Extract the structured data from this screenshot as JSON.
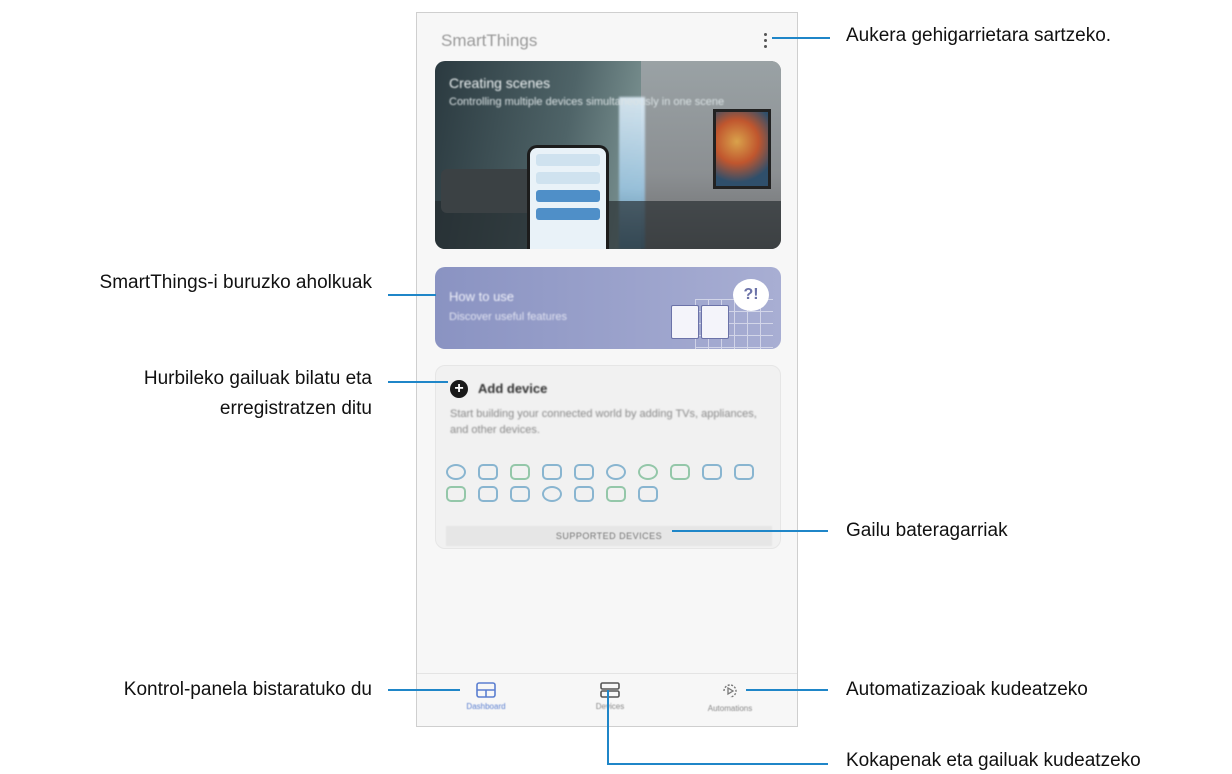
{
  "app": {
    "title": "SmartThings",
    "hero": {
      "title": "Creating scenes",
      "subtitle": "Controlling multiple devices simultaneously in one scene"
    },
    "tips": {
      "title": "How to use",
      "subtitle": "Discover useful features"
    },
    "add_device": {
      "title": "Add device",
      "description": "Start building your connected world by adding TVs, appliances, and other devices.",
      "supported_label": "SUPPORTED DEVICES"
    },
    "nav": {
      "dashboard": "Dashboard",
      "devices": "Devices",
      "automations": "Automations"
    }
  },
  "callouts": {
    "more_options": "Aukera gehigarrietara sartzeko.",
    "tips": "SmartThings-i buruzko aholkuak",
    "nearby_line1": "Hurbileko gailuak bilatu eta",
    "nearby_line2": "erregistratzen ditu",
    "compatible": "Gailu bateragarriak",
    "dashboard": "Kontrol-panela bistaratuko du",
    "automations": "Automatizazioak kudeatzeko",
    "locations": "Kokapenak eta gailuak kudeatzeko"
  },
  "colors": {
    "callout_line": "#1f86c8",
    "nav_active": "#5b7fd0"
  }
}
